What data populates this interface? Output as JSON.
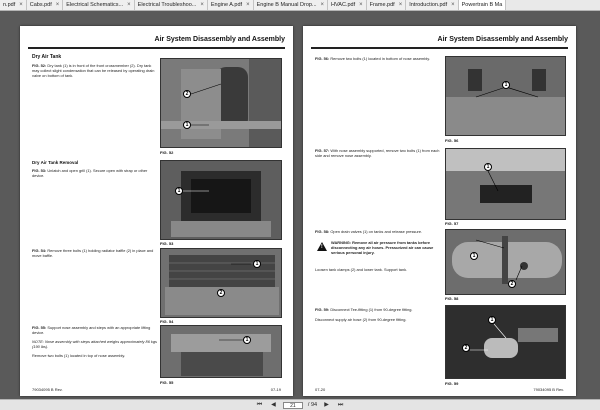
{
  "tabs": [
    {
      "label": "n.pdf"
    },
    {
      "label": "Cabs.pdf"
    },
    {
      "label": "Electrical Schematics..."
    },
    {
      "label": "Electrical Troubleshoo..."
    },
    {
      "label": "Engine A.pdf"
    },
    {
      "label": "Engine B Manual Drop..."
    },
    {
      "label": "HVAC.pdf"
    },
    {
      "label": "Frame.pdf"
    },
    {
      "label": "Introduction.pdf"
    },
    {
      "label": "Powertrain B Ma"
    }
  ],
  "left_page": {
    "header": "Air System Disassembly and Assembly",
    "section1_title": "Dry Air Tank",
    "fig52_text_label": "FIG. 52:",
    "fig52_text": "Dry tank (1) is in front of the front crossmember (2). Dry tank may collect slight condensation that can be released by operating drain valve on bottom of tank.",
    "fig52_caption": "FIG. 52",
    "section2_title": "Dry Air Tank Removal",
    "fig53_text_label": "FIG. 53:",
    "fig53_text": "Unlatch and open grill (1). Secure open with strap or other device.",
    "fig53_caption": "FIG. 53",
    "fig54_text_label": "FIG. 54:",
    "fig54_text": "Remove three bolts (1) holding radiator baffle (2) in place and move baffle.",
    "fig54_caption": "FIG. 54",
    "fig55_text_label": "FIG. 55:",
    "fig55_text": "Support nose assembly and steps with an appropriate lifting device.",
    "fig55_note": "NOTE: Nose assembly with steps attached weighs approximately 86 kgs (190 lbs).",
    "fig55_text2": "Remove two bolts (1) located in top of nose assembly.",
    "fig55_caption": "FIG. 55",
    "footer_left": "79034095 B Rev.",
    "footer_right": "07-19"
  },
  "right_page": {
    "header": "Air System Disassembly and Assembly",
    "fig56_text_label": "FIG. 56:",
    "fig56_text": "Remove two bolts (1) located in bottom of nose assembly.",
    "fig56_caption": "FIG. 56",
    "fig57_text_label": "FIG. 57:",
    "fig57_text": "With nose assembly supported, remove two bolts (1) from each side and remove nose assembly.",
    "fig57_caption": "FIG. 57",
    "fig58_text_label": "FIG. 58:",
    "fig58_text": "Open drain valves (1) on tanks and release pressure.",
    "warning_text": "WARNING: Remove all air pressure from tanks before disconnecting any air hoses. Pressurized air can cause serious personal injury.",
    "fig58_text2": "Loosen tank clamps (2) and lower tank. Support tank.",
    "fig58_caption": "FIG. 58",
    "fig59_text_label": "FIG. 59:",
    "fig59_text": "Disconnect Tee-fitting (1) from 90-degree fitting.",
    "fig59_text2": "Disconnect supply air hose (2) from 90-degree fitting.",
    "fig59_caption": "FIG. 59",
    "footer_left": "07-20",
    "footer_right": "79034095 B Rev."
  },
  "callouts": {
    "one": "1",
    "two": "2"
  },
  "statusbar": {
    "page_value": "21",
    "page_total": "/ 94"
  }
}
